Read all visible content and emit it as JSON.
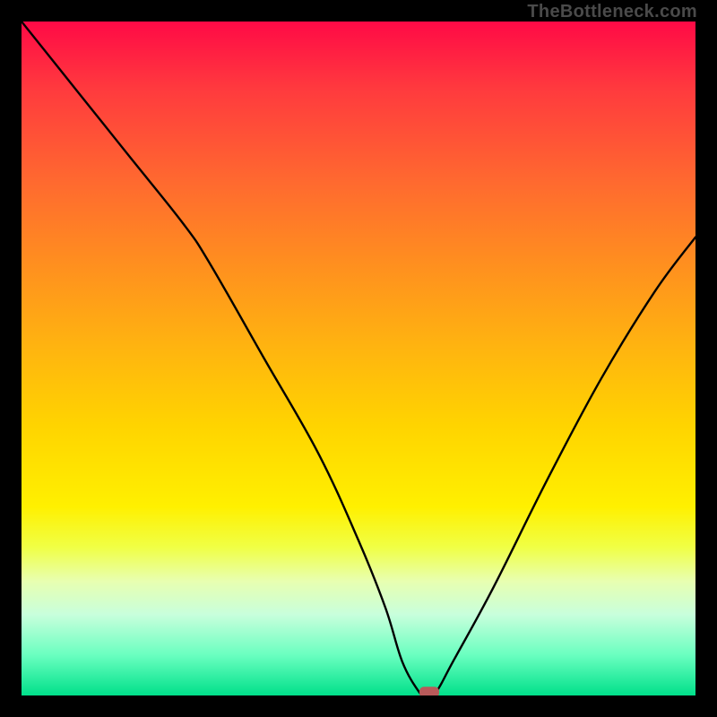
{
  "watermark": "TheBottleneck.com",
  "chart_data": {
    "type": "line",
    "title": "",
    "xlabel": "",
    "ylabel": "",
    "xlim": [
      0,
      100
    ],
    "ylim": [
      0,
      100
    ],
    "x": [
      0,
      8,
      16,
      24,
      28,
      36,
      44,
      50,
      54,
      56.5,
      59,
      60,
      61.5,
      64,
      70,
      78,
      86,
      94,
      100
    ],
    "values": [
      100,
      90,
      80,
      70,
      64,
      50,
      36,
      23,
      13,
      5,
      0.5,
      0,
      0.5,
      5,
      16,
      32,
      47,
      60,
      68
    ],
    "marker": {
      "x": 60.5,
      "y": 0.5,
      "color": "#b85a5a"
    },
    "gradient_stops": [
      {
        "pos": 0.0,
        "color": "#ff0a46"
      },
      {
        "pos": 0.6,
        "color": "#ffd400"
      },
      {
        "pos": 0.82,
        "color": "#f4ff8a"
      },
      {
        "pos": 1.0,
        "color": "#00e08a"
      }
    ]
  }
}
